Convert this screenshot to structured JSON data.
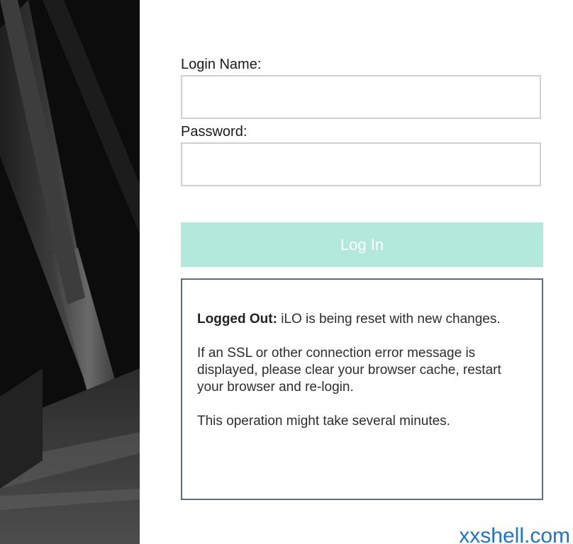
{
  "form": {
    "login_name_label": "Login Name:",
    "login_name_value": "",
    "password_label": "Password:",
    "password_value": "",
    "login_button_label": "Log In",
    "login_button_color": "#b3e8dc"
  },
  "message": {
    "status_prefix": "Logged Out:",
    "status_text": " iLO is being reset with new changes.",
    "ssl_text": "If an SSL or other connection error message is displayed, please clear your browser cache, restart your browser and re-login.",
    "duration_text": "This operation might take several minutes.",
    "border_color": "#5a6f85"
  },
  "watermark": {
    "text": "xxshell.com",
    "color": "#1f73c8"
  }
}
